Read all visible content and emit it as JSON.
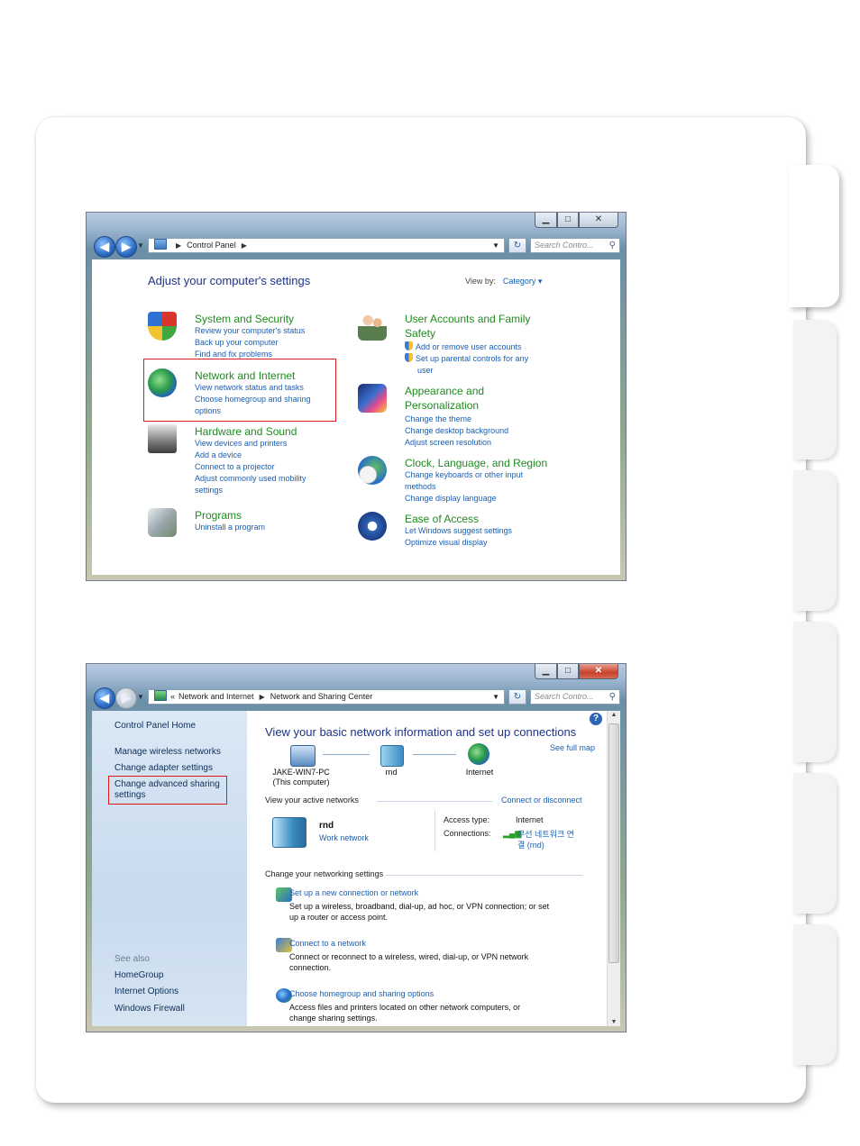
{
  "colors": {
    "accent_link": "#1a5fb4",
    "category_green": "#1f8a1f",
    "heading_blue": "#1e3287",
    "highlight_red": "#e0191b"
  },
  "window1": {
    "address": {
      "crumb": "Control Panel",
      "search_placeholder": "Search Contro..."
    },
    "heading": "Adjust your computer's settings",
    "view_by": {
      "label": "View by:",
      "value": "Category"
    },
    "categories": [
      {
        "title": "System and Security",
        "icon": "shield-icon",
        "links": [
          "Review your computer's status",
          "Back up your computer",
          "Find and fix problems"
        ]
      },
      {
        "title": "Network and Internet",
        "icon": "globe-network-icon",
        "links": [
          "View network status and tasks",
          "Choose homegroup and sharing",
          "options"
        ]
      },
      {
        "title": "Hardware and Sound",
        "icon": "printer-icon",
        "links": [
          "View devices and printers",
          "Add a device",
          "Connect to a projector",
          "Adjust commonly used mobility",
          "settings"
        ]
      },
      {
        "title": "Programs",
        "icon": "programs-icon",
        "links": [
          "Uninstall a program"
        ]
      },
      {
        "title_lines": [
          "User Accounts and Family",
          "Safety"
        ],
        "icon": "users-icon",
        "links": [
          "Add or remove user accounts",
          "Set up parental controls for any",
          "user"
        ]
      },
      {
        "title_lines": [
          "Appearance and",
          "Personalization"
        ],
        "icon": "monitor-paint-icon",
        "links": [
          "Change the theme",
          "Change desktop background",
          "Adjust screen resolution"
        ]
      },
      {
        "title": "Clock, Language, and Region",
        "icon": "clock-globe-icon",
        "links": [
          "Change keyboards or other input",
          "methods",
          "Change display language"
        ]
      },
      {
        "title": "Ease of Access",
        "icon": "ease-of-access-icon",
        "links": [
          "Let Windows suggest settings",
          "Optimize visual display"
        ]
      }
    ]
  },
  "window2": {
    "address": {
      "crumb1": "Network and Internet",
      "crumb2": "Network and Sharing Center",
      "search_placeholder": "Search Contro..."
    },
    "left": {
      "home": "Control Panel Home",
      "items": [
        "Manage wireless networks",
        "Change adapter settings",
        "Change advanced sharing",
        "settings"
      ],
      "see_also": "See also",
      "see_also_items": [
        "HomeGroup",
        "Internet Options",
        "Windows Firewall"
      ]
    },
    "main": {
      "title": "View your basic network information and set up connections",
      "see_full_map": "See full map",
      "nodes": [
        {
          "label": "JAKE-WIN7-PC",
          "sub": "(This computer)"
        },
        {
          "label": "rnd",
          "sub": ""
        },
        {
          "label": "Internet",
          "sub": ""
        }
      ],
      "active_networks_label": "View your active networks",
      "connect_disconnect": "Connect or disconnect",
      "network_name": "rnd",
      "network_type": "Work network",
      "access_type_label": "Access type:",
      "access_type_value": "Internet",
      "connections_label": "Connections:",
      "connections_value_line1": "무선 네트워크 연",
      "connections_value_line2": "결 (rnd)",
      "change_settings_label": "Change your networking settings",
      "tasks": [
        {
          "link": "Set up a new connection or network",
          "desc": [
            "Set up a wireless, broadband, dial-up, ad hoc, or VPN connection; or set",
            "up a router or access point."
          ]
        },
        {
          "link": "Connect to a network",
          "desc": [
            "Connect or reconnect to a wireless, wired, dial-up, or VPN network",
            "connection."
          ]
        },
        {
          "link": "Choose homegroup and sharing options",
          "desc": [
            "Access files and printers located on other network computers, or",
            "change sharing settings."
          ]
        }
      ]
    }
  }
}
